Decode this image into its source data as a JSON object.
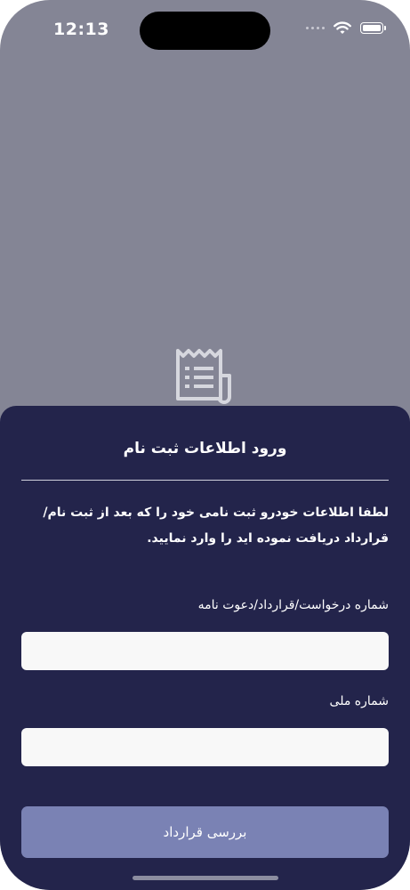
{
  "status_bar": {
    "time": "12:13",
    "icons": [
      "signal-dots-icon",
      "wifi-icon",
      "battery-icon"
    ]
  },
  "background_icon": "receipt-icon",
  "sheet": {
    "title": "ورود اطلاعات ثبت نام",
    "instruction": "لطفا اطلاعات خودرو ثبت نامی خود را که بعد از ثبت نام/قرارداد دریافت نموده اید را وارد نمایید.",
    "fields": [
      {
        "label": "شماره درخواست/قرارداد/دعوت نامه",
        "value": "",
        "placeholder": ""
      },
      {
        "label": "شماره ملی",
        "value": "",
        "placeholder": ""
      }
    ],
    "submit_label": "بررسی قرارداد"
  },
  "colors": {
    "backdrop": "#848595",
    "sheet_background": "#23244b",
    "input_background": "#f8f8f8",
    "button_background": "#7a82b4",
    "text": "#ffffff"
  }
}
